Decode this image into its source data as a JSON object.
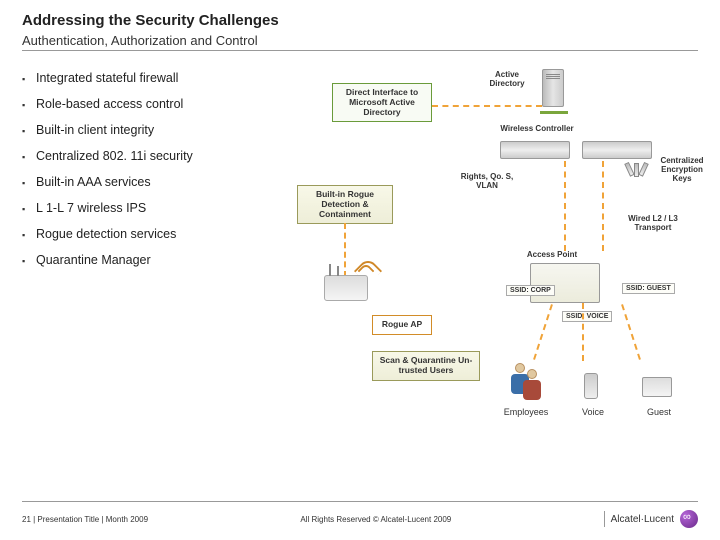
{
  "title": "Addressing the Security Challenges",
  "subtitle": "Authentication, Authorization and Control",
  "bullets": [
    "Integrated stateful firewall",
    "Role-based access control",
    "Built-in client integrity",
    "Centralized 802. 11i security",
    "Built-in AAA services",
    "L 1-L 7 wireless IPS",
    "Rogue detection services",
    "Quarantine Manager"
  ],
  "boxes": {
    "direct_interface": "Direct Interface to Microsoft Active Directory",
    "rogue_detection": "Built-in Rogue Detection & Containment",
    "scan_quarantine": "Scan & Quarantine Un-trusted Users"
  },
  "labels": {
    "active_directory": "Active Directory",
    "wireless_controller": "Wireless Controller",
    "rights_qos_vlan": "Rights, Qo. S, VLAN",
    "enc_keys": "Centralized Encryption Keys",
    "wired_transport": "Wired L2 / L3 Transport",
    "access_point": "Access Point",
    "rogue_ap": "Rogue AP"
  },
  "ssid": {
    "corp": "SSID: CORP",
    "voice": "SSID: VOICE",
    "guest": "SSID: GUEST"
  },
  "clients": {
    "employees": "Employees",
    "voice": "Voice",
    "guest": "Guest"
  },
  "footer": {
    "left": "21 | Presentation Title | Month 2009",
    "center": "All Rights Reserved © Alcatel-Lucent 2009",
    "brand": "Alcatel·Lucent"
  }
}
